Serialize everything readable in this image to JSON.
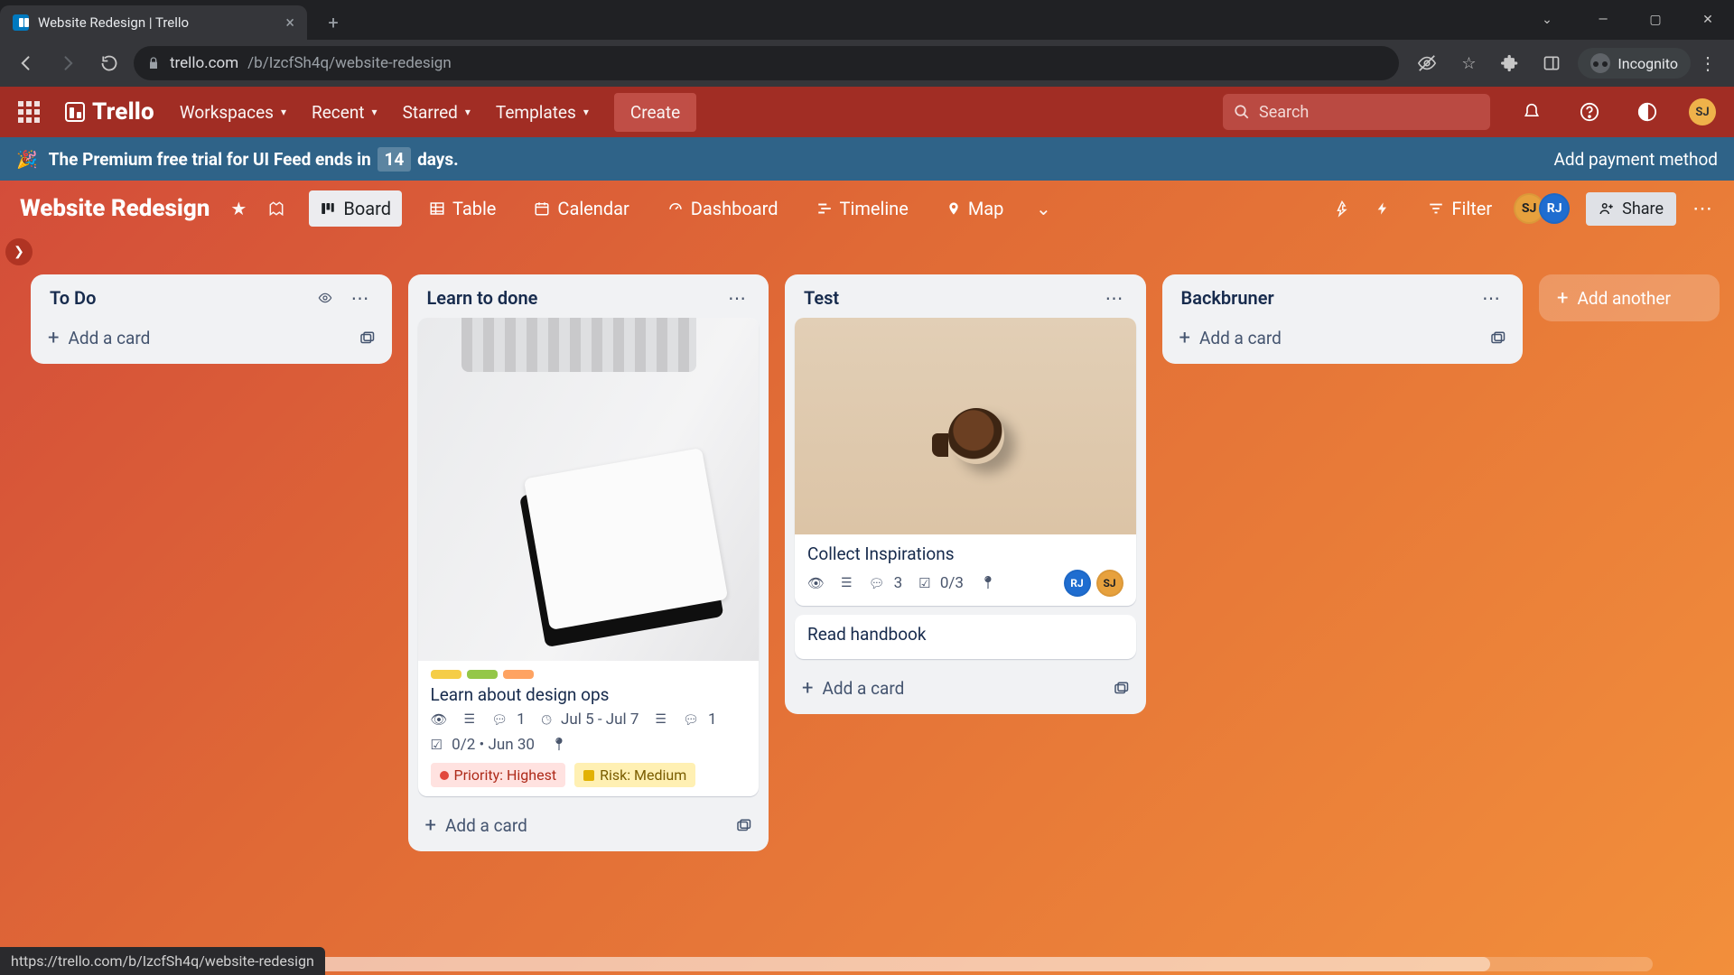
{
  "browser": {
    "tab_title": "Website Redesign | Trello",
    "incognito_label": "Incognito",
    "url_host": "trello.com",
    "url_path": "/b/IzcfSh4q/website-redesign",
    "status_url": "https://trello.com/b/IzcfSh4q/website-redesign"
  },
  "topbar": {
    "brand": "Trello",
    "menus": [
      "Workspaces",
      "Recent",
      "Starred",
      "Templates"
    ],
    "create": "Create",
    "search_placeholder": "Search",
    "right_avatar_initials": "SJ"
  },
  "premium_banner": {
    "text_a": "The Premium free trial for UI Feed ends in",
    "days": "14",
    "text_b": "days.",
    "cta": "Add payment method"
  },
  "board_header": {
    "title": "Website Redesign",
    "views": [
      "Board",
      "Table",
      "Calendar",
      "Dashboard",
      "Timeline",
      "Map"
    ],
    "filter": "Filter",
    "share": "Share",
    "members": [
      "SJ",
      "RJ"
    ]
  },
  "lists": [
    {
      "title": "To Do",
      "show_watch": true,
      "cards": [],
      "add_label": "Add a card"
    },
    {
      "title": "Learn to done",
      "cards": [
        {
          "title": "Learn about design ops",
          "cover": "learn",
          "labels": [
            "y",
            "l",
            "o"
          ],
          "watch": true,
          "date": "Jul 5 - Jul 7",
          "desc": true,
          "comments": "1",
          "check_summary": "0/2 • Jun 30",
          "loc": true,
          "cf": [
            {
              "style": "red",
              "text": "Priority: Highest"
            },
            {
              "style": "yel",
              "text": "Risk: Medium"
            }
          ]
        }
      ],
      "add_label": "Add a card",
      "scroll": true
    },
    {
      "title": "Test",
      "cards": [
        {
          "title": "Collect Inspirations",
          "cover": "test",
          "watch": true,
          "desc": true,
          "comments": "3",
          "check_summary": "0/3",
          "loc": true,
          "members": [
            "RJ",
            "SJ"
          ]
        },
        {
          "title": "Read handbook"
        }
      ],
      "add_label": "Add a card"
    },
    {
      "title": "Backbruner",
      "cards": [],
      "add_label": "Add a card"
    }
  ],
  "add_another_list": "Add another"
}
